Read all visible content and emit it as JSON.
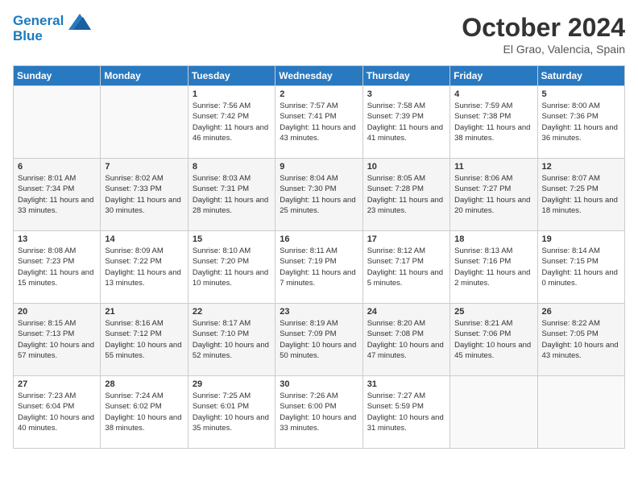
{
  "header": {
    "logo_line1": "General",
    "logo_line2": "Blue",
    "month_title": "October 2024",
    "location": "El Grao, Valencia, Spain"
  },
  "days_of_week": [
    "Sunday",
    "Monday",
    "Tuesday",
    "Wednesday",
    "Thursday",
    "Friday",
    "Saturday"
  ],
  "weeks": [
    [
      {
        "day": "",
        "info": ""
      },
      {
        "day": "",
        "info": ""
      },
      {
        "day": "1",
        "info": "Sunrise: 7:56 AM\nSunset: 7:42 PM\nDaylight: 11 hours and 46 minutes."
      },
      {
        "day": "2",
        "info": "Sunrise: 7:57 AM\nSunset: 7:41 PM\nDaylight: 11 hours and 43 minutes."
      },
      {
        "day": "3",
        "info": "Sunrise: 7:58 AM\nSunset: 7:39 PM\nDaylight: 11 hours and 41 minutes."
      },
      {
        "day": "4",
        "info": "Sunrise: 7:59 AM\nSunset: 7:38 PM\nDaylight: 11 hours and 38 minutes."
      },
      {
        "day": "5",
        "info": "Sunrise: 8:00 AM\nSunset: 7:36 PM\nDaylight: 11 hours and 36 minutes."
      }
    ],
    [
      {
        "day": "6",
        "info": "Sunrise: 8:01 AM\nSunset: 7:34 PM\nDaylight: 11 hours and 33 minutes."
      },
      {
        "day": "7",
        "info": "Sunrise: 8:02 AM\nSunset: 7:33 PM\nDaylight: 11 hours and 30 minutes."
      },
      {
        "day": "8",
        "info": "Sunrise: 8:03 AM\nSunset: 7:31 PM\nDaylight: 11 hours and 28 minutes."
      },
      {
        "day": "9",
        "info": "Sunrise: 8:04 AM\nSunset: 7:30 PM\nDaylight: 11 hours and 25 minutes."
      },
      {
        "day": "10",
        "info": "Sunrise: 8:05 AM\nSunset: 7:28 PM\nDaylight: 11 hours and 23 minutes."
      },
      {
        "day": "11",
        "info": "Sunrise: 8:06 AM\nSunset: 7:27 PM\nDaylight: 11 hours and 20 minutes."
      },
      {
        "day": "12",
        "info": "Sunrise: 8:07 AM\nSunset: 7:25 PM\nDaylight: 11 hours and 18 minutes."
      }
    ],
    [
      {
        "day": "13",
        "info": "Sunrise: 8:08 AM\nSunset: 7:23 PM\nDaylight: 11 hours and 15 minutes."
      },
      {
        "day": "14",
        "info": "Sunrise: 8:09 AM\nSunset: 7:22 PM\nDaylight: 11 hours and 13 minutes."
      },
      {
        "day": "15",
        "info": "Sunrise: 8:10 AM\nSunset: 7:20 PM\nDaylight: 11 hours and 10 minutes."
      },
      {
        "day": "16",
        "info": "Sunrise: 8:11 AM\nSunset: 7:19 PM\nDaylight: 11 hours and 7 minutes."
      },
      {
        "day": "17",
        "info": "Sunrise: 8:12 AM\nSunset: 7:17 PM\nDaylight: 11 hours and 5 minutes."
      },
      {
        "day": "18",
        "info": "Sunrise: 8:13 AM\nSunset: 7:16 PM\nDaylight: 11 hours and 2 minutes."
      },
      {
        "day": "19",
        "info": "Sunrise: 8:14 AM\nSunset: 7:15 PM\nDaylight: 11 hours and 0 minutes."
      }
    ],
    [
      {
        "day": "20",
        "info": "Sunrise: 8:15 AM\nSunset: 7:13 PM\nDaylight: 10 hours and 57 minutes."
      },
      {
        "day": "21",
        "info": "Sunrise: 8:16 AM\nSunset: 7:12 PM\nDaylight: 10 hours and 55 minutes."
      },
      {
        "day": "22",
        "info": "Sunrise: 8:17 AM\nSunset: 7:10 PM\nDaylight: 10 hours and 52 minutes."
      },
      {
        "day": "23",
        "info": "Sunrise: 8:19 AM\nSunset: 7:09 PM\nDaylight: 10 hours and 50 minutes."
      },
      {
        "day": "24",
        "info": "Sunrise: 8:20 AM\nSunset: 7:08 PM\nDaylight: 10 hours and 47 minutes."
      },
      {
        "day": "25",
        "info": "Sunrise: 8:21 AM\nSunset: 7:06 PM\nDaylight: 10 hours and 45 minutes."
      },
      {
        "day": "26",
        "info": "Sunrise: 8:22 AM\nSunset: 7:05 PM\nDaylight: 10 hours and 43 minutes."
      }
    ],
    [
      {
        "day": "27",
        "info": "Sunrise: 7:23 AM\nSunset: 6:04 PM\nDaylight: 10 hours and 40 minutes."
      },
      {
        "day": "28",
        "info": "Sunrise: 7:24 AM\nSunset: 6:02 PM\nDaylight: 10 hours and 38 minutes."
      },
      {
        "day": "29",
        "info": "Sunrise: 7:25 AM\nSunset: 6:01 PM\nDaylight: 10 hours and 35 minutes."
      },
      {
        "day": "30",
        "info": "Sunrise: 7:26 AM\nSunset: 6:00 PM\nDaylight: 10 hours and 33 minutes."
      },
      {
        "day": "31",
        "info": "Sunrise: 7:27 AM\nSunset: 5:59 PM\nDaylight: 10 hours and 31 minutes."
      },
      {
        "day": "",
        "info": ""
      },
      {
        "day": "",
        "info": ""
      }
    ]
  ]
}
